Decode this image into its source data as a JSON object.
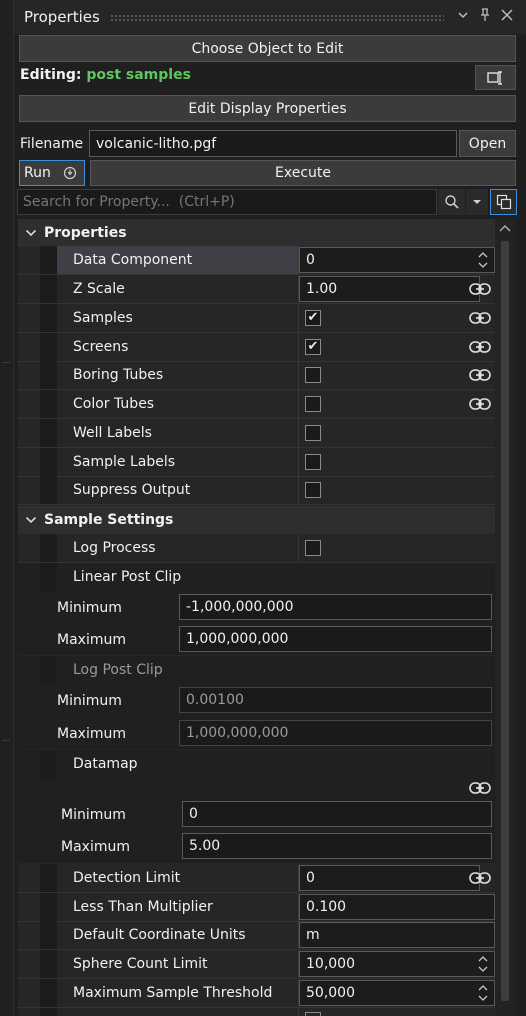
{
  "panel": {
    "title": "Properties"
  },
  "toolbar": {
    "choose_label": "Choose Object to Edit",
    "editing_label": "Editing:",
    "editing_value": "post samples",
    "edit_display_label": "Edit Display Properties",
    "filename_label": "Filename",
    "filename_value": "volcanic-litho.pgf",
    "open_label": "Open",
    "run_label": "Run",
    "execute_label": "Execute"
  },
  "search": {
    "placeholder": "Search for Property...  (Ctrl+P)"
  },
  "categories": [
    {
      "label": "Properties"
    },
    {
      "label": "Sample Settings"
    }
  ],
  "props": [
    {
      "name": "Data Component",
      "value": "0"
    },
    {
      "name": "Z Scale",
      "value": "1.00"
    },
    {
      "name": "Samples",
      "checked": true
    },
    {
      "name": "Screens",
      "checked": true
    },
    {
      "name": "Boring Tubes",
      "checked": false
    },
    {
      "name": "Color Tubes",
      "checked": false
    },
    {
      "name": "Well Labels",
      "checked": false
    },
    {
      "name": "Sample Labels",
      "checked": false
    },
    {
      "name": "Suppress Output",
      "checked": false
    }
  ],
  "sample": {
    "log_process": "Log Process",
    "linear_post_clip": "Linear Post Clip",
    "linear_min_label": "Minimum",
    "linear_min_value": "-1,000,000,000",
    "linear_max_label": "Maximum",
    "linear_max_value": "1,000,000,000",
    "log_post_clip": "Log Post Clip",
    "log_min_label": "Minimum",
    "log_min_value": "0.00100",
    "log_max_label": "Maximum",
    "log_max_value": "1,000,000,000",
    "datamap": "Datamap",
    "dm_min_label": "Minimum",
    "dm_min_value": "0",
    "dm_max_label": "Maximum",
    "dm_max_value": "5.00",
    "detection_limit": "Detection Limit",
    "detection_limit_value": "0",
    "less_than": "Less Than Multiplier",
    "less_than_value": "0.100",
    "coord_units": "Default Coordinate Units",
    "coord_units_value": "m",
    "sphere_count": "Sphere Count Limit",
    "sphere_count_value": "10,000",
    "max_threshold": "Maximum Sample Threshold",
    "max_threshold_value": "50,000"
  }
}
